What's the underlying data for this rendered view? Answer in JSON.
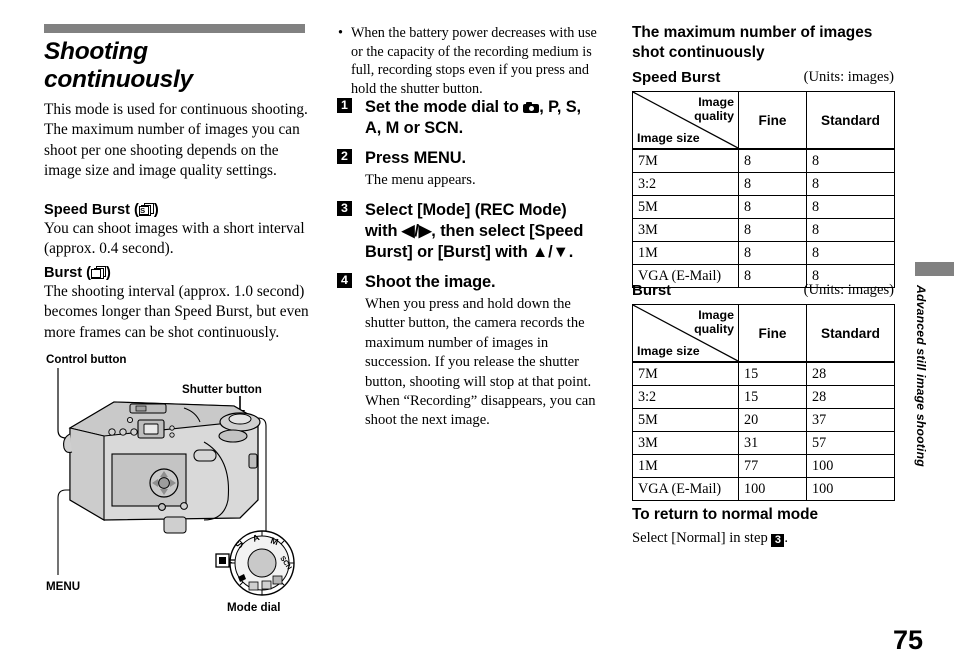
{
  "document": {
    "page_number": "75",
    "side_tab": "Advanced still image shooting"
  },
  "left_column": {
    "title_line1": "Shooting",
    "title_line2": "continuously",
    "intro": "This mode is used for continuous shooting. The maximum number of images you can shoot per one shooting depends on the image size and image quality settings.",
    "speed_burst": {
      "heading_prefix": "Speed Burst (",
      "heading_suffix": ")",
      "icon": "speed-burst-icon",
      "body": "You can shoot images with a short interval (approx. 0.4 second)."
    },
    "burst": {
      "heading_prefix": "Burst (",
      "heading_suffix": ")",
      "icon": "burst-icon",
      "body": "The shooting interval (approx. 1.0 second) becomes longer than Speed Burst, but even more frames can be shot continuously."
    },
    "figure_labels": {
      "control_button": "Control button",
      "shutter_button": "Shutter button",
      "menu": "MENU",
      "mode_dial": "Mode dial"
    },
    "mode_dial_positions": [
      "P",
      "S",
      "A",
      "M",
      "SCN"
    ]
  },
  "middle_column": {
    "note_bullet": "•",
    "note": "When the battery power decreases with use or the capacity of the recording medium is full, recording stops even if you press and hold the shutter button.",
    "steps": [
      {
        "number": "1",
        "title_before_icon": "Set the mode dial to ",
        "icon": "camera-mode-icon",
        "title_after_icon": ", P, S, A, M or SCN.",
        "body": ""
      },
      {
        "number": "2",
        "title": "Press MENU.",
        "body": "The menu appears."
      },
      {
        "number": "3",
        "title": "Select [Mode] (REC Mode) with ◀/▶, then select [Speed Burst] or [Burst] with ▲/▼.",
        "body": ""
      },
      {
        "number": "4",
        "title": "Shoot the image.",
        "body": "When you press and hold down the shutter button, the camera records the maximum number of images in succession. If you release the shutter button, shooting will stop at that point. When “Recording” disappears, you can shoot the next image."
      }
    ]
  },
  "right_column": {
    "heading": "The maximum number of images shot continuously",
    "speed_burst_table": {
      "caption": "Speed Burst",
      "units": "(Units: images)",
      "corner_quality_label": "Image quality",
      "corner_size_label": "Image size",
      "columns": [
        "Fine",
        "Standard"
      ],
      "rows": [
        {
          "size": "7M",
          "fine": "8",
          "standard": "8"
        },
        {
          "size": "3:2",
          "fine": "8",
          "standard": "8"
        },
        {
          "size": "5M",
          "fine": "8",
          "standard": "8"
        },
        {
          "size": "3M",
          "fine": "8",
          "standard": "8"
        },
        {
          "size": "1M",
          "fine": "8",
          "standard": "8"
        },
        {
          "size": "VGA (E-Mail)",
          "fine": "8",
          "standard": "8"
        }
      ]
    },
    "burst_table": {
      "caption": "Burst",
      "units": "(Units: images)",
      "corner_quality_label": "Image quality",
      "corner_size_label": "Image size",
      "columns": [
        "Fine",
        "Standard"
      ],
      "rows": [
        {
          "size": "7M",
          "fine": "15",
          "standard": "28"
        },
        {
          "size": "3:2",
          "fine": "15",
          "standard": "28"
        },
        {
          "size": "5M",
          "fine": "20",
          "standard": "37"
        },
        {
          "size": "3M",
          "fine": "31",
          "standard": "57"
        },
        {
          "size": "1M",
          "fine": "77",
          "standard": "100"
        },
        {
          "size": "VGA (E-Mail)",
          "fine": "100",
          "standard": "100"
        }
      ]
    },
    "return_section": {
      "heading": "To return to normal mode",
      "body_before": "Select [Normal] in step ",
      "step_ref": "3",
      "body_after": "."
    }
  },
  "colors": {
    "rule_bar": "#818181",
    "text": "#000000",
    "page_background": "#ffffff"
  }
}
